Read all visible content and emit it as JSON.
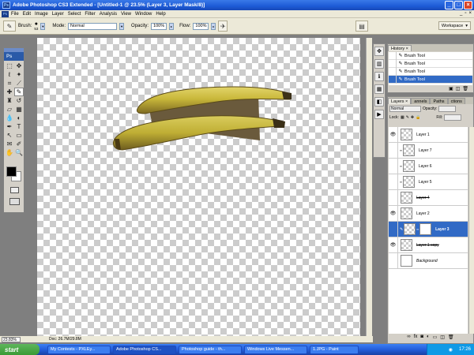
{
  "window": {
    "title": "Adobe Photoshop CS3 Extended - [Untitled-1 @ 23.5% (Layer 3, Layer Mask/8)]",
    "logo": "Ps"
  },
  "menu": [
    "File",
    "Edit",
    "Image",
    "Layer",
    "Select",
    "Filter",
    "Analysis",
    "View",
    "Window",
    "Help"
  ],
  "options": {
    "brush_label": "Brush:",
    "brush_size": "53",
    "mode_label": "Mode:",
    "mode_value": "Normal",
    "opacity_label": "Opacity:",
    "opacity_value": "100%",
    "flow_label": "Flow:",
    "flow_value": "100%",
    "workspace_label": "Workspace"
  },
  "toolbox": {
    "logo": "Ps"
  },
  "status": {
    "zoom": "23.83%",
    "doc_info": "Doc: 26.7M/29.8M"
  },
  "history": {
    "tab": "History",
    "items": [
      {
        "label": "Brush Tool"
      },
      {
        "label": "Brush Tool"
      },
      {
        "label": "Brush Tool"
      },
      {
        "label": "Brush Tool",
        "selected": true
      }
    ]
  },
  "layers_panel": {
    "tabs": [
      "Layers",
      "annels",
      "Paths",
      "ctions"
    ],
    "blend_mode": "Normal",
    "opacity_label": "Opacity:",
    "lock_label": "Lock:",
    "fill_label": "Fill:",
    "layers": [
      {
        "name": "Layer 1",
        "visible": true
      },
      {
        "name": "Layer 7",
        "visible": false
      },
      {
        "name": "Layer 6",
        "visible": false
      },
      {
        "name": "Layer 5",
        "visible": false
      },
      {
        "name": "Layer 4",
        "visible": false,
        "struck": true
      },
      {
        "name": "Layer 2",
        "visible": true
      },
      {
        "name": "Layer 3",
        "visible": false,
        "selected": true,
        "mask": true
      },
      {
        "name": "Layer 1 copy",
        "visible": true,
        "struck": true
      },
      {
        "name": "Background",
        "visible": false,
        "background": true
      }
    ]
  },
  "taskbar": {
    "start": "start",
    "tasks": [
      {
        "label": "My Contests - PXLEy..."
      },
      {
        "label": "Adobe Photoshop CS...",
        "active": true
      },
      {
        "label": "Photoshop guide - th..."
      },
      {
        "label": "Windows Live Messen..."
      },
      {
        "label": "1.JPG - Paint"
      }
    ],
    "clock": "17:26"
  },
  "colors": {
    "titlebar": "#1d5bd6",
    "selection": "#316ac5",
    "banana_yellow": "#c9b83a",
    "banana_shadow": "#6a5a3c"
  }
}
